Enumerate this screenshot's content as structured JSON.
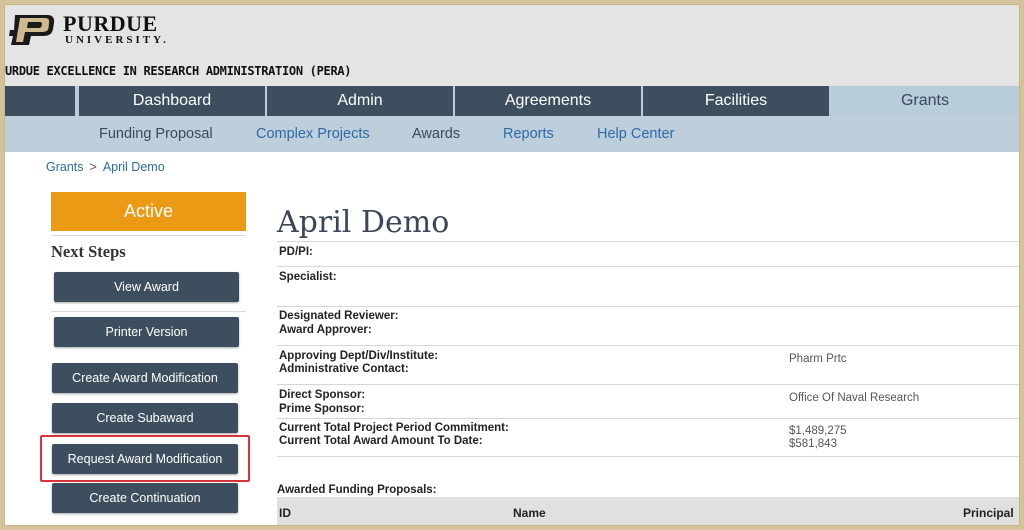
{
  "header": {
    "logo_letter": "P",
    "logo_name": "PURDUE",
    "logo_sub": "UNIVERSITY.",
    "org_title": "URDUE EXCELLENCE IN RESEARCH ADMINISTRATION (PERA)"
  },
  "nav": {
    "tabs": [
      {
        "label": "Dashboard"
      },
      {
        "label": "Admin"
      },
      {
        "label": "Agreements"
      },
      {
        "label": "Facilities"
      },
      {
        "label": "Grants",
        "active": true
      }
    ]
  },
  "subnav": {
    "items": [
      "Funding Proposal",
      "Complex Projects",
      "Awards",
      "Reports",
      "Help Center"
    ]
  },
  "breadcrumb": {
    "root": "Grants",
    "separator": ">",
    "current": "April Demo"
  },
  "sidebar": {
    "status": "Active",
    "next_steps_title": "Next Steps",
    "buttons": [
      "View Award",
      "Printer Version",
      "Create Award Modification",
      "Create Subaward",
      "Request Award Modification",
      "Create Continuation"
    ]
  },
  "main": {
    "title": "April Demo",
    "fields": {
      "pdpi": "PD/PI:",
      "specialist": "Specialist:",
      "designated_reviewer": "Designated Reviewer:",
      "award_approver": "Award Approver:",
      "approving_dept": "Approving Dept/Div/Institute:",
      "admin_contact": "Administrative Contact:",
      "approving_dept_value": "Pharm Prtc",
      "direct_sponsor": "Direct Sponsor:",
      "prime_sponsor": "Prime Sponsor:",
      "direct_sponsor_value": "Office Of Naval Research",
      "period_commitment": "Current Total Project Period Commitment:",
      "award_to_date": "Current Total Award Amount To Date:",
      "period_commitment_value": "$1,489,275",
      "award_to_date_value": "$581,843"
    },
    "awarded_title": "Awarded Funding Proposals:",
    "table_headers": [
      "ID",
      "Name",
      "Principal"
    ]
  },
  "colors": {
    "nav_dark": "#3d4f5f",
    "nav_light": "#b8cdd9",
    "status_orange": "#ec9a16",
    "link_blue": "#2d6aa6",
    "highlight_red": "#d9323a"
  }
}
